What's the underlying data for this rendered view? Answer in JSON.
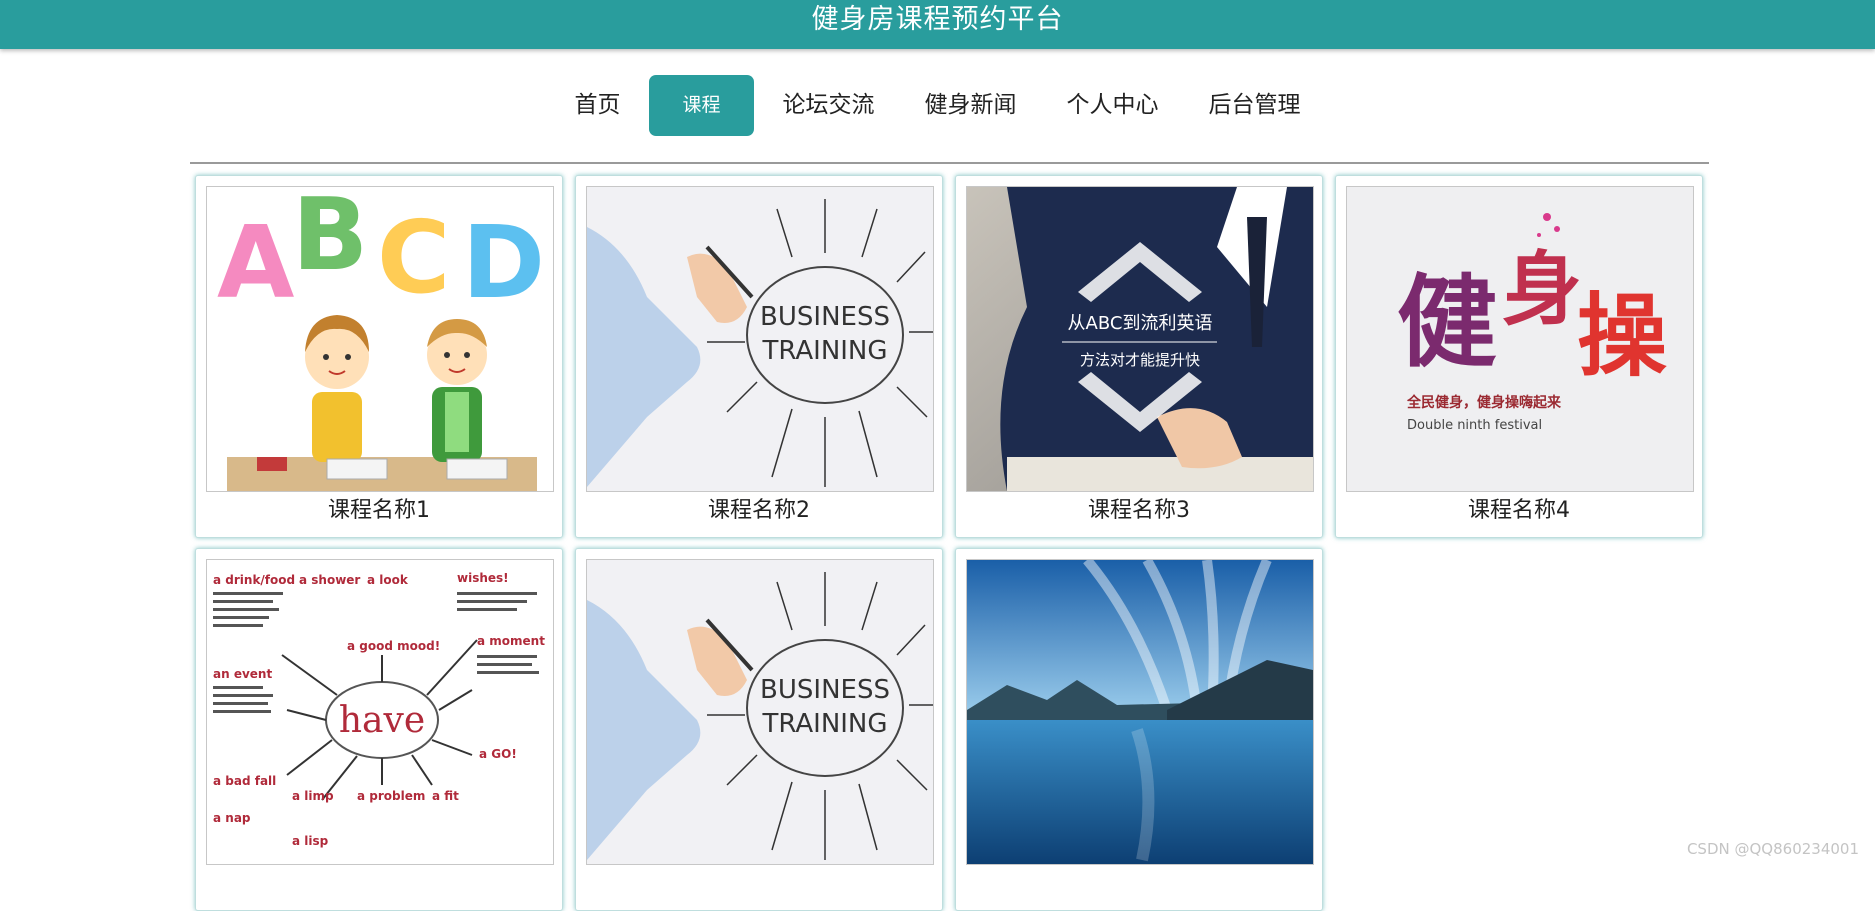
{
  "header": {
    "title": "健身房课程预约平台"
  },
  "nav": {
    "items": [
      {
        "label": "首页"
      },
      {
        "label": "课程"
      },
      {
        "label": "论坛交流"
      },
      {
        "label": "健身新闻"
      },
      {
        "label": "个人中心"
      },
      {
        "label": "后台管理"
      }
    ],
    "active": "课程"
  },
  "courses": [
    {
      "title": "课程名称1",
      "image": "abcd-kids-illustration",
      "image_text": "ABCD"
    },
    {
      "title": "课程名称2",
      "image": "business-training-sketch",
      "image_text": "BUSINESS TRAINING"
    },
    {
      "title": "课程名称3",
      "image": "english-study-photo",
      "image_text": "从ABC到流利英语 方法对才能提升快"
    },
    {
      "title": "课程名称4",
      "image": "fitness-calligraphy-poster",
      "image_text": "健身操 全民健身，健身操嗨起来 Double ninth festival"
    },
    {
      "title": "",
      "image": "have-vocabulary-mindmap",
      "image_text": "a drink/food a shower a look wishes! a good mood! an event have a moment a GO! a bad fall a limp a problem a fit a nap a lisp"
    },
    {
      "title": "",
      "image": "business-training-sketch",
      "image_text": "BUSINESS TRAINING"
    },
    {
      "title": "",
      "image": "mountain-lake-photo",
      "image_text": ""
    }
  ],
  "watermark": "CSDN @QQ860234001",
  "colors": {
    "accent": "#299d9d",
    "text": "#222222",
    "divider": "#9a9a9a"
  }
}
